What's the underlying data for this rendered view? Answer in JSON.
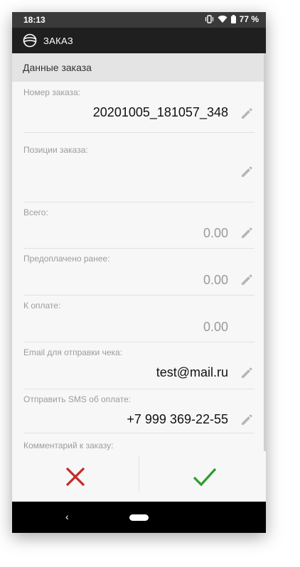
{
  "status_bar": {
    "time": "18:13",
    "battery": "77 %"
  },
  "app_bar": {
    "title": "ЗАКАЗ"
  },
  "section": {
    "title": "Данные заказа"
  },
  "fields": [
    {
      "label": "Номер заказа:",
      "value": "20201005_181057_348",
      "editable": true
    },
    {
      "label": "Позиции заказа:",
      "value": "",
      "editable": true
    },
    {
      "label": "Всего:",
      "value": "0.00",
      "editable": true
    },
    {
      "label": "Предоплачено ранее:",
      "value": "0.00",
      "editable": true
    },
    {
      "label": "К оплате:",
      "value": "0.00",
      "editable": false
    },
    {
      "label": "Email для отправки чека:",
      "value": "test@mail.ru",
      "editable": true
    },
    {
      "label": "Отправить SMS об оплате:",
      "value": "+7 999 369-22-55",
      "editable": true
    },
    {
      "label": "Комментарий к заказу:",
      "value": "",
      "editable": true
    }
  ],
  "actions": {
    "cancel": "cancel",
    "confirm": "confirm"
  },
  "colors": {
    "cancel": "#c62828",
    "confirm": "#2e9d2e",
    "app_bar": "#1f1f1f",
    "status_bar": "#3a3a3a"
  },
  "icons": [
    "vibrate-icon",
    "wifi-icon",
    "battery-icon",
    "logo-icon",
    "edit-pencil-icon",
    "close-icon",
    "check-icon",
    "back-icon",
    "home-icon"
  ]
}
